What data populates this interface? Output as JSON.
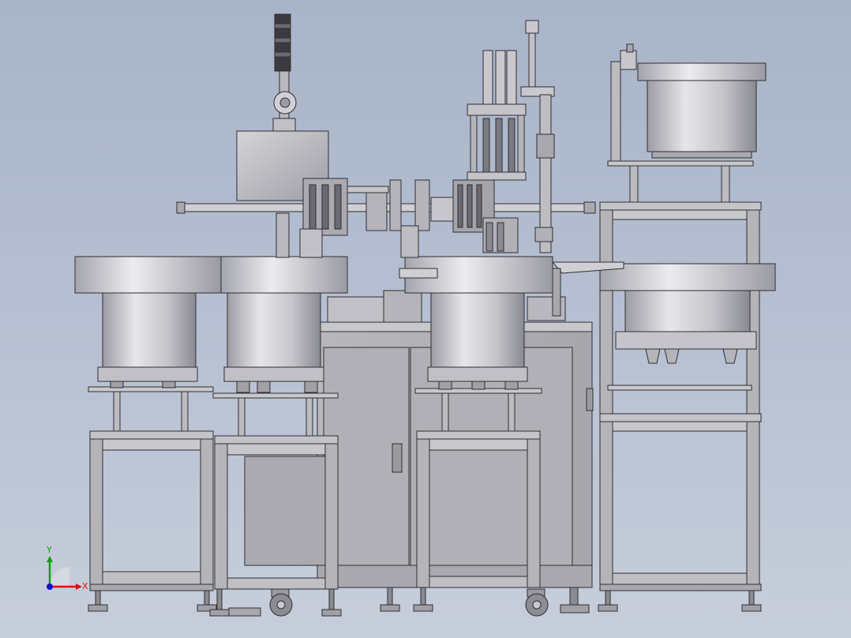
{
  "colors": {
    "background_top": "#a9b4c8",
    "background_bottom": "#c7cedb",
    "metal_light": "#e0e0e4",
    "metal_mid": "#bdbdc2",
    "metal_dark": "#8e8e96",
    "outline": "#2e2e33",
    "axis_x": "#e01010",
    "axis_y": "#10a010",
    "axis_z": "#1010d0"
  },
  "triad": {
    "x_label": "X",
    "y_label": "Y"
  }
}
